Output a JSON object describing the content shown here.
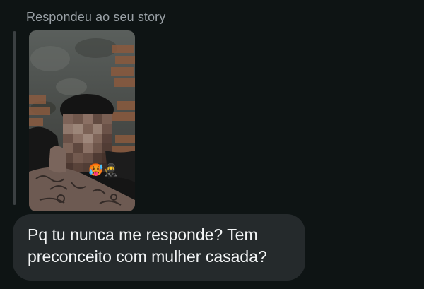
{
  "story_reply": {
    "caption": "Respondeu ao seu story",
    "thumbnail_description_icon": "story-photo",
    "reaction_emojis": [
      "🥵",
      "🥷"
    ]
  },
  "message": {
    "text": "Pq tu nunca me responde? Tem\npreconceito com mulher casada?"
  },
  "colors": {
    "background": "#0e1414",
    "bubble": "#252a2c",
    "caption": "#9aa1a6",
    "message_text": "#f2f4f5",
    "reply_bar": "#3b4042"
  }
}
